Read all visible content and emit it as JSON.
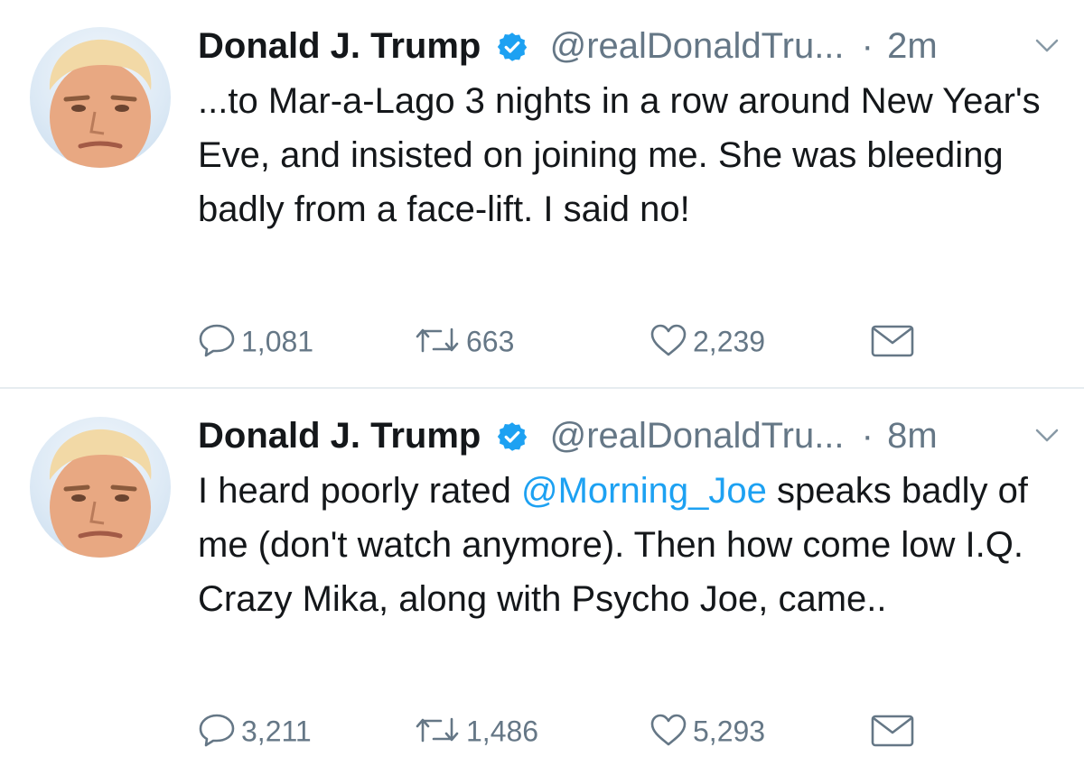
{
  "colors": {
    "text": "#14171a",
    "secondary": "#657786",
    "link": "#1da1f2",
    "verified": "#1da1f2",
    "divider": "#e6ecf0"
  },
  "tweets": [
    {
      "author_name": "Donald J. Trump",
      "handle": "@realDonaldTru...",
      "separator": "·",
      "time": "2m",
      "text_before": "...to Mar-a-Lago 3 nights in a row around New Year's Eve, and insisted on joining me. She was bleeding badly from a face-lift. I said no!",
      "mention": "",
      "text_after": "",
      "replies": "1,081",
      "retweets": "663",
      "likes": "2,239",
      "icons": [
        "avatar",
        "verified-badge-icon",
        "chevron-down-icon",
        "reply-icon",
        "retweet-icon",
        "like-icon",
        "dm-icon"
      ]
    },
    {
      "author_name": "Donald J. Trump",
      "handle": "@realDonaldTru...",
      "separator": "·",
      "time": "8m",
      "text_before": "I heard poorly rated ",
      "mention": "@Morning_Joe",
      "text_after": " speaks badly of me (don't watch anymore). Then how come low I.Q. Crazy Mika, along with Psycho Joe, came..",
      "replies": "3,211",
      "retweets": "1,486",
      "likes": "5,293",
      "icons": [
        "avatar",
        "verified-badge-icon",
        "chevron-down-icon",
        "reply-icon",
        "retweet-icon",
        "like-icon",
        "dm-icon"
      ]
    }
  ]
}
